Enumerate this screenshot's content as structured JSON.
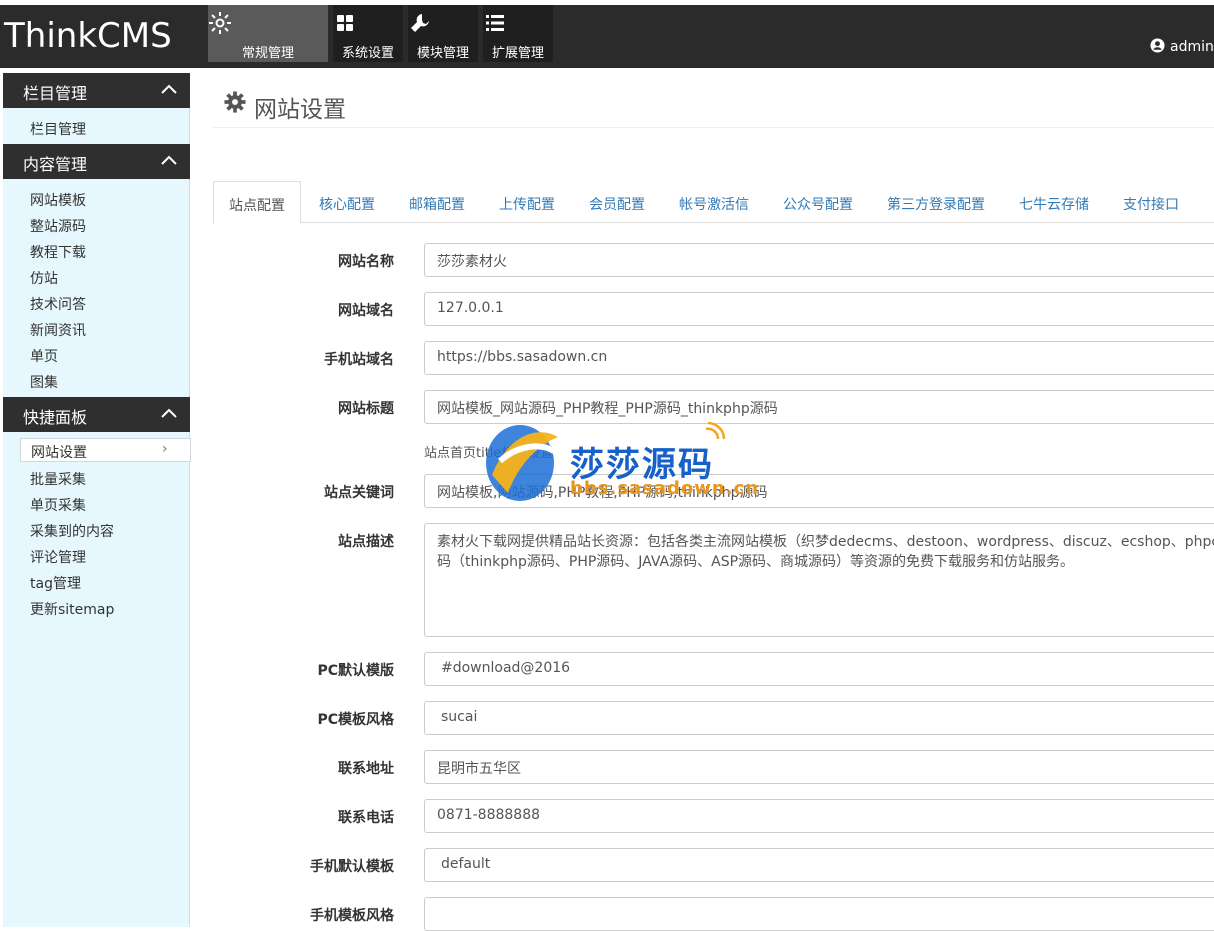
{
  "brand": "ThinkCMS",
  "nav": [
    {
      "label": "常规管理",
      "icon": "sun-icon"
    },
    {
      "label": "系统设置",
      "icon": "grid-icon"
    },
    {
      "label": "模块管理",
      "icon": "wrench-icon"
    },
    {
      "label": "扩展管理",
      "icon": "list-icon"
    }
  ],
  "user": {
    "name": "admin"
  },
  "sidebar": {
    "sections": [
      {
        "title": "栏目管理",
        "items": [
          "栏目管理"
        ]
      },
      {
        "title": "内容管理",
        "items": [
          "网站模板",
          "整站源码",
          "教程下载",
          "仿站",
          "技术问答",
          "新闻资讯",
          "单页",
          "图集"
        ]
      },
      {
        "title": "快捷面板",
        "items": [
          "网站设置",
          "批量采集",
          "单页采集",
          "采集到的内容",
          "评论管理",
          "tag管理",
          "更新sitemap"
        ]
      }
    ],
    "active_arrow": "›"
  },
  "page_title": "网站设置",
  "tabs": [
    "站点配置",
    "核心配置",
    "邮箱配置",
    "上传配置",
    "会员配置",
    "帐号激活信",
    "公众号配置",
    "第三方登录配置",
    "七牛云存储",
    "支付接口"
  ],
  "form": {
    "site_name": {
      "label": "网站名称",
      "value": "莎莎素材火"
    },
    "site_domain": {
      "label": "网站域名",
      "value": "127.0.0.1"
    },
    "mobile_domain": {
      "label": "手机站域名",
      "value": "https://bbs.sasadown.cn"
    },
    "site_title": {
      "label": "网站标题",
      "value": "网站模板_网站源码_PHP教程_PHP源码_thinkphp源码",
      "help": "站点首页title标题设置"
    },
    "keywords": {
      "label": "站点关键词",
      "value": "网站模板,网站源码,PHP教程,PHP源码,thinkphp源码"
    },
    "description": {
      "label": "站点描述",
      "line1": "素材火下载网提供精品站长资源：包括各类主流网站模板（织梦dedecms、destoon、wordpress、discuz、ecshop、phpcms等）、整站源",
      "line2": "码（thinkphp源码、PHP源码、JAVA源码、ASP源码、商城源码）等资源的免费下载服务和仿站服务。"
    },
    "pc_template": {
      "label": "PC默认模版",
      "value": "#download@2016"
    },
    "pc_style": {
      "label": "PC模板风格",
      "value": "sucai"
    },
    "address": {
      "label": "联系地址",
      "value": "昆明市五华区"
    },
    "phone": {
      "label": "联系电话",
      "value": "0871-8888888"
    },
    "mobile_template": {
      "label": "手机默认模板",
      "value": "default"
    },
    "mobile_style": {
      "label": "手机模板风格",
      "value": ""
    }
  },
  "watermark": {
    "title": "莎莎源码",
    "url": "bbs.sasadown.cn"
  }
}
